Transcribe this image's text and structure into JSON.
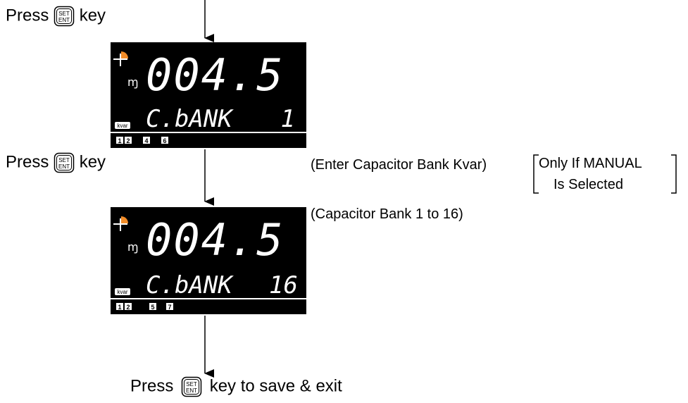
{
  "step1": {
    "press": "Press",
    "key": "key"
  },
  "step2": {
    "press": "Press",
    "key": "key"
  },
  "final": {
    "press": "Press",
    "tail": "key to save & exit"
  },
  "key_icon": {
    "top": "SET",
    "bottom": "ENT"
  },
  "display1": {
    "value": "004.5",
    "text": "C.bANK",
    "bank": "1",
    "unit": "kvar",
    "leds": [
      "1",
      "2",
      "4",
      "6"
    ]
  },
  "display2": {
    "value": "004.5",
    "text": "C.bANK",
    "bank": "16",
    "unit": "kvar",
    "leds": [
      "1",
      "2",
      "5",
      "7"
    ]
  },
  "notes": {
    "enter_kvar": "(Enter Capacitor Bank Kvar)",
    "bank_range": "(Capacitor Bank 1 to 16)",
    "only_if": "Only If MANUAL",
    "is_selected": "Is Selected"
  },
  "colors": {
    "lcd_bg": "#000000",
    "lcd_fg": "#ffffff",
    "accent": "#f28c28"
  }
}
